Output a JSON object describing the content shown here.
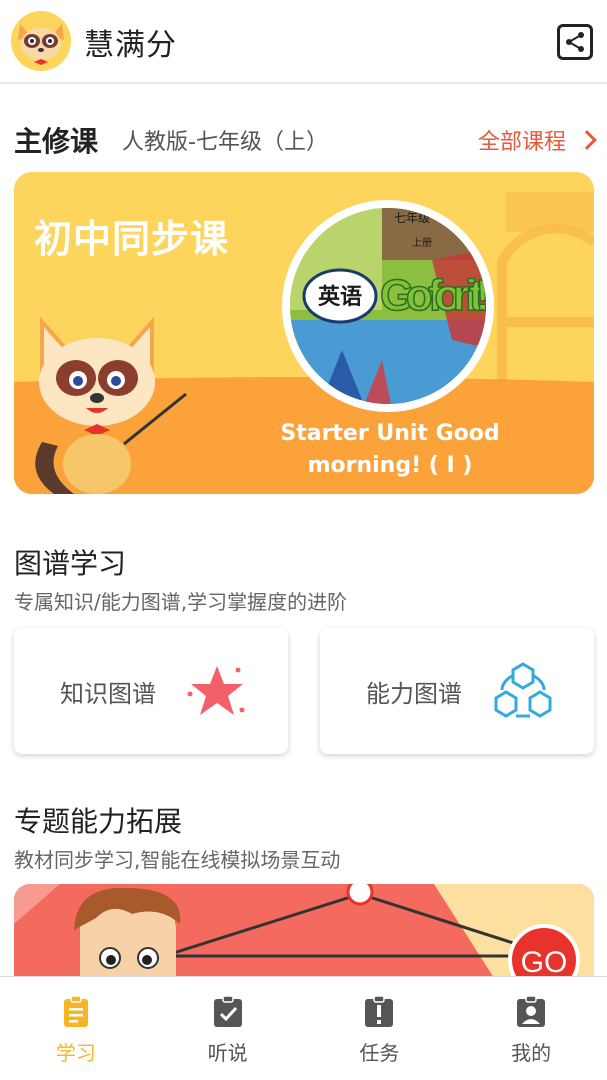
{
  "header": {
    "app_title": "慧满分",
    "logo_icon": "raccoon-logo-icon",
    "share_icon": "share-icon"
  },
  "main_course": {
    "title": "主修课",
    "edition": "人教版-七年级（上）",
    "all_courses_label": "全部课程",
    "banner_heading": "初中同步课",
    "book_subject": "英语",
    "book_text": "Go for it!",
    "book_grade": "七年级",
    "book_volume": "上册",
    "unit_title": "Starter Unit Good morning! ( I )"
  },
  "graph_learning": {
    "title": "图谱学习",
    "subtitle": "专属知识/能力图谱,学习掌握度的进阶",
    "cards": [
      {
        "label": "知识图谱",
        "icon": "star-icon"
      },
      {
        "label": "能力图谱",
        "icon": "hexagon-network-icon"
      }
    ]
  },
  "topic": {
    "title": "专题能力拓展",
    "subtitle": "教材同步学习,智能在线模拟场景互动",
    "go_label": "GO"
  },
  "nav": {
    "items": [
      {
        "label": "学习",
        "icon": "clipboard-list-icon",
        "active": true
      },
      {
        "label": "听说",
        "icon": "clipboard-check-icon",
        "active": false
      },
      {
        "label": "任务",
        "icon": "alert-clipboard-icon",
        "active": false
      },
      {
        "label": "我的",
        "icon": "user-badge-icon",
        "active": false
      }
    ]
  },
  "colors": {
    "accent": "#f6b623",
    "link": "#e85a3c",
    "banner_yellow": "#fdd45c",
    "banner_orange": "#fba33a",
    "topic_red": "#f56a5f"
  }
}
